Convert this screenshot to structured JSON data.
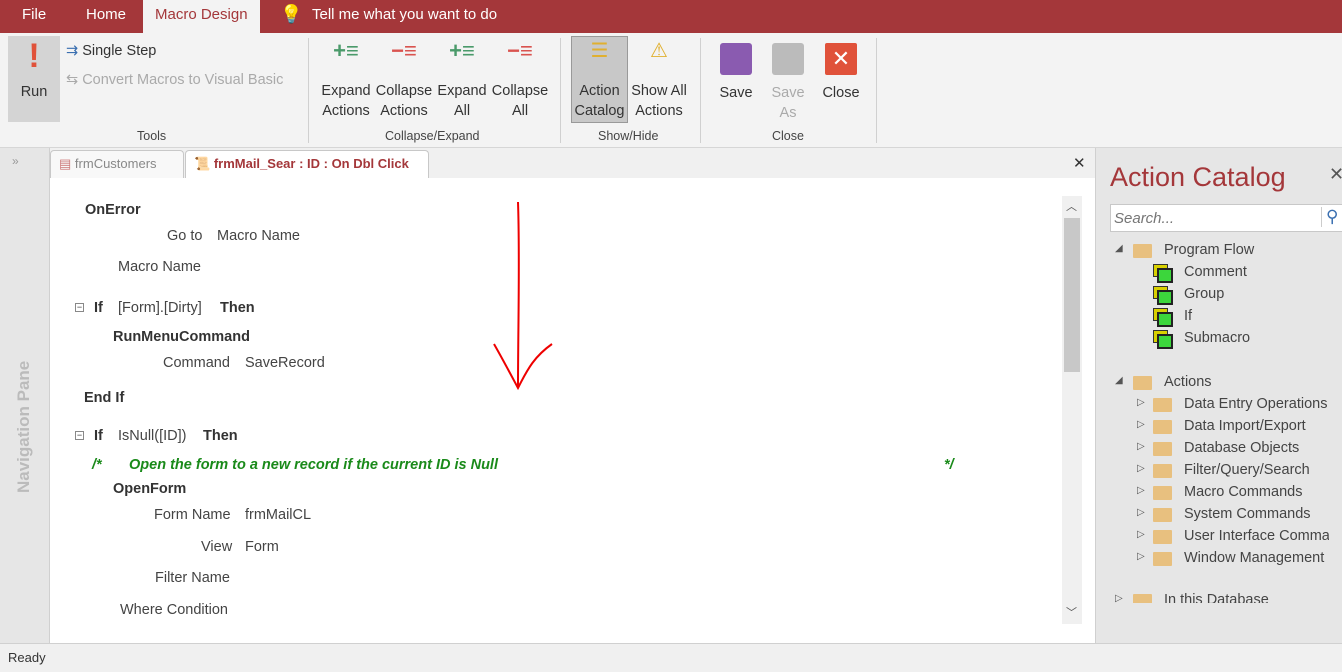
{
  "menu": {
    "file": "File",
    "home": "Home",
    "macro_design": "Macro Design",
    "tell_me": "Tell me what you want to do"
  },
  "ribbon": {
    "run": "Run",
    "single_step": "Single Step",
    "convert": "Convert Macros to Visual Basic",
    "tools_group": "Tools",
    "expand_actions": [
      "Expand",
      "Actions"
    ],
    "collapse_actions": [
      "Collapse",
      "Actions"
    ],
    "expand_all": [
      "Expand",
      "All"
    ],
    "collapse_all": [
      "Collapse",
      "All"
    ],
    "collapse_expand_group": "Collapse/Expand",
    "action_catalog": [
      "Action",
      "Catalog"
    ],
    "show_all_actions": [
      "Show All",
      "Actions"
    ],
    "show_hide_group": "Show/Hide",
    "save": "Save",
    "save_as": [
      "Save",
      "As"
    ],
    "close": "Close",
    "close_group": "Close"
  },
  "nav_pane": "Navigation Pane",
  "doc_tabs": [
    {
      "label": "frmCustomers"
    },
    {
      "label": "frmMail_Sear : ID : On Dbl Click"
    }
  ],
  "macro": {
    "onerror": "OnError",
    "goto_label": "Go to",
    "goto_value": "Macro Name",
    "macro_name_label": "Macro Name",
    "if1": "If",
    "if1_cond": "[Form].[Dirty]",
    "then": "Then",
    "runmenu": "RunMenuCommand",
    "command_label": "Command",
    "command_value": "SaveRecord",
    "endif": "End If",
    "if2": "If",
    "if2_cond": "IsNull([ID])",
    "comment_open": "/*",
    "comment": "Open the form to a new record if the current ID is Null",
    "comment_close": "*/",
    "openform": "OpenForm",
    "form_name_label": "Form Name",
    "form_name_value": "frmMailCL",
    "view_label": "View",
    "view_value": "Form",
    "filter_label": "Filter Name",
    "where_label": "Where Condition"
  },
  "catalog": {
    "title": "Action Catalog",
    "search_placeholder": "Search...",
    "program_flow": "Program Flow",
    "flow_items": [
      "Comment",
      "Group",
      "If",
      "Submacro"
    ],
    "actions": "Actions",
    "action_items": [
      "Data Entry Operations",
      "Data Import/Export",
      "Database Objects",
      "Filter/Query/Search",
      "Macro Commands",
      "System Commands",
      "User Interface Commands",
      "Window Management"
    ],
    "in_db": "In this Database"
  },
  "status": "Ready",
  "colors": {
    "accent": "#a4373a",
    "comment": "#1a8a1a"
  }
}
